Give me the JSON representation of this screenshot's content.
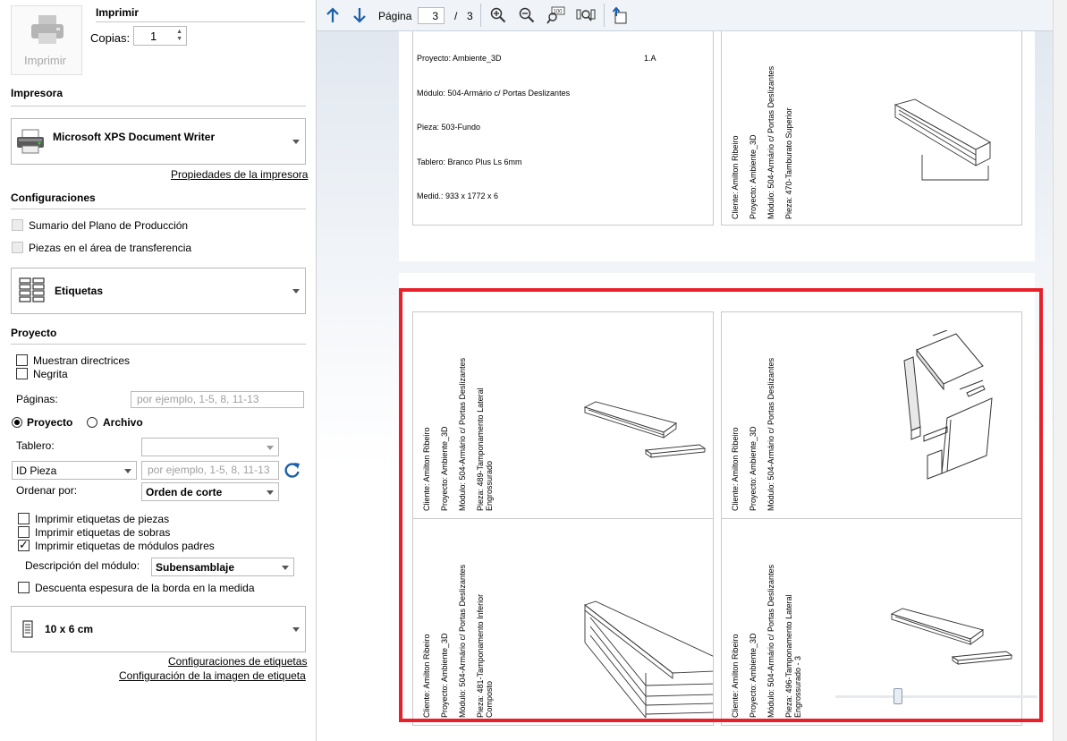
{
  "print": {
    "heading": "Imprimir",
    "button_label": "Imprimir",
    "copies_label": "Copias:",
    "copies_value": "1"
  },
  "printer": {
    "heading": "Impresora",
    "name": "Microsoft XPS Document Writer",
    "properties_link": "Propiedades de la impresora"
  },
  "settings": {
    "heading": "Configuraciones",
    "summary_option": "Sumario del Plano de Producción",
    "transfer_option": "Piezas en el área de transferencia",
    "mode": "Etiquetas"
  },
  "project": {
    "heading": "Proyecto",
    "show_guides": "Muestran directrices",
    "bold": "Negrita",
    "pages_label": "Páginas:",
    "pages_placeholder": "por ejemplo, 1-5, 8, 11-13",
    "radio_project": "Proyecto",
    "radio_file": "Archivo",
    "board_label": "Tablero:",
    "id_select": "ID Pieza",
    "id_placeholder": "por ejemplo, 1-5, 8, 11-13",
    "sort_label": "Ordenar por:",
    "sort_value": "Orden de corte",
    "print_parts": "Imprimir etiquetas de piezas",
    "print_leftovers": "Imprimir etiquetas de sobras",
    "print_parent_modules": "Imprimir etiquetas de módulos padres",
    "module_desc_label": "Descripción del módulo:",
    "module_desc_value": "Subensamblaje",
    "discount_edge": "Descuenta espesura de la borda en la medida",
    "label_size": "10 x 6 cm",
    "label_settings_link": "Configuraciones de etiquetas",
    "label_image_link": "Configuración de la imagen de etiqueta"
  },
  "toolbar": {
    "page_label": "Página",
    "current_page": "3",
    "separator": "/",
    "total_pages": "3"
  },
  "preview": {
    "top_left": {
      "project": "Proyecto: Ambiente_3D",
      "code": "1.A",
      "module": "Módulo: 504-Armário c/ Portas Deslizantes",
      "piece": "Pieza: 503-Fundo",
      "board": "Tablero: Branco Plus Ls 6mm",
      "measure": "Medid.: 933 x 1772 x 6"
    },
    "top_right": {
      "client": "Cliente: Amilton Ribeiro",
      "project": "Proyecto: Ambiente_3D",
      "module": "Módulo: 504-Armário c/ Portas Deslizantes",
      "piece": "Pieza: 470-Tamburato Superior"
    },
    "card1": {
      "client": "Cliente: Amilton Ribeiro",
      "project": "Proyecto: Ambiente_3D",
      "module": "Módulo: 504-Armário c/ Portas Deslizantes",
      "piece": "Pieza: 489-Tamponamento Lateral",
      "piece2": "Engrossurado"
    },
    "card2": {
      "client": "Cliente: Amilton Ribeiro",
      "project": "Proyecto: Ambiente_3D",
      "module": "Módulo: 504-Armário c/ Portas Deslizantes"
    },
    "card3": {
      "client": "Cliente: Amilton Ribeiro",
      "project": "Proyecto: Ambiente_3D",
      "module": "Módulo: 504-Armário c/ Portas Deslizantes",
      "piece": "Pieza: 481-Tamponamento Inferior",
      "piece2": "Composto"
    },
    "card4": {
      "client": "Cliente: Amilton Ribeiro",
      "project": "Proyecto: Ambiente_3D",
      "module": "Módulo: 504-Armário c/ Portas Deslizantes",
      "piece": "Pieza: 496-Tamponamento Lateral",
      "piece2": "Engrossurado - 3"
    }
  },
  "colors": {
    "highlight": "#e8202a",
    "accent": "#1a5fa8",
    "preview_bg": "#dfe6ef"
  }
}
